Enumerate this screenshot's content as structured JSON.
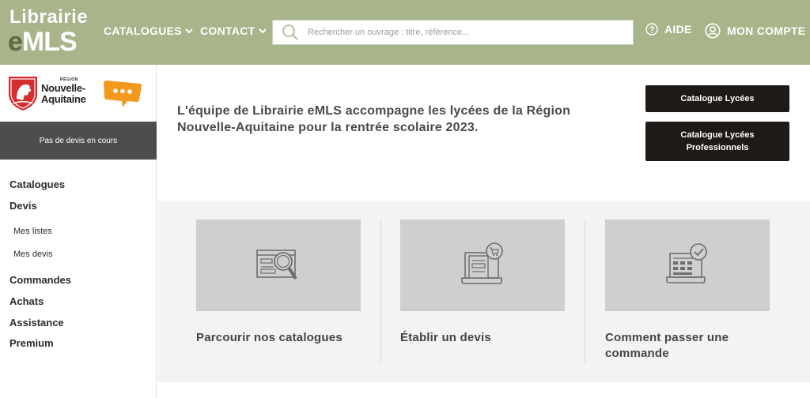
{
  "header": {
    "logo_line1": "Librairie",
    "logo_line2_prefix": "e",
    "logo_line2_rest": "MLS",
    "nav": [
      {
        "label": "CATALOGUES"
      },
      {
        "label": "CONTACT"
      }
    ],
    "search_placeholder": "Rechercher un ouvrage : titre, référence...",
    "help_label": "AIDE",
    "account_label": "MON COMPTE"
  },
  "sidebar": {
    "region_small": "RÉGION",
    "region_line1": "Nouvelle-",
    "region_line2": "Aquitaine",
    "devis_status": "Pas de devis en cours",
    "menu": {
      "catalogues": "Catalogues",
      "devis": "Devis",
      "mes_listes": "Mes listes",
      "mes_devis": "Mes devis",
      "commandes": "Commandes",
      "achats": "Achats",
      "assistance": "Assistance",
      "premium": "Premium"
    }
  },
  "intro": {
    "text": "L'équipe de Librairie eMLS accompagne les lycées de la Région Nouvelle-Aquitaine pour la rentrée scolaire 2023.",
    "button1": "Catalogue Lycées",
    "button2_line1": "Catalogue Lycées",
    "button2_line2": "Professionnels"
  },
  "cards": [
    {
      "title": "Parcourir nos catalogues",
      "icon": "catalog-search-icon"
    },
    {
      "title": "Établir un devis",
      "icon": "quote-cart-icon"
    },
    {
      "title": "Comment passer une commande",
      "icon": "order-check-icon"
    }
  ],
  "colors": {
    "header_bg": "#a8b48a",
    "logo_accent": "#5b6a45",
    "dark_button": "#1f1a17",
    "devis_bar": "#4d4d4d",
    "card_image": "#cfcfcf",
    "cards_bg": "#f3f3f3",
    "chat_orange": "#f39a1e",
    "region_red": "#d42e2e"
  }
}
